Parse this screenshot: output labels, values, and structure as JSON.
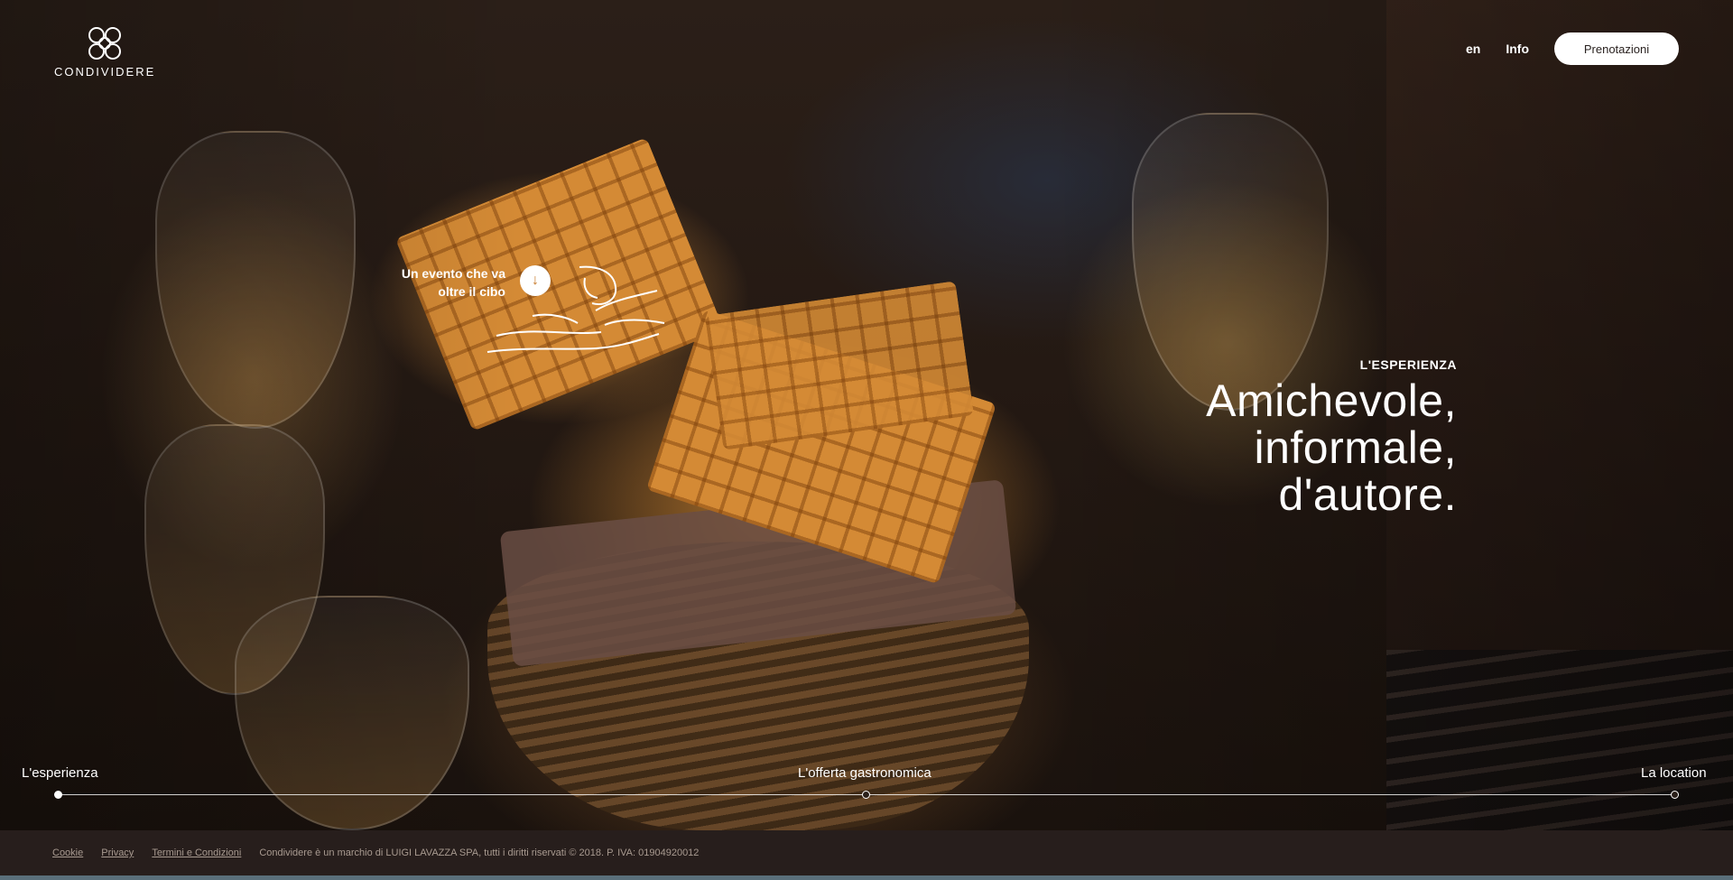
{
  "header": {
    "logo_text": "CONDIVIDERE",
    "nav": {
      "lang": "en",
      "info": "Info",
      "reserve": "Prenotazioni"
    }
  },
  "teaser": {
    "text_line1": "Un evento che va",
    "text_line2": "oltre il cibo",
    "arrow_icon": "arrow-down-icon"
  },
  "hero": {
    "eyebrow": "L'ESPERIENZA",
    "headline_line1": "Amichevole,",
    "headline_line2": "informale,",
    "headline_line3": "d'autore."
  },
  "timeline": {
    "stops": [
      {
        "label": "L'esperienza",
        "active": true
      },
      {
        "label": "L'offerta gastronomica",
        "active": false
      },
      {
        "label": "La location",
        "active": false
      }
    ]
  },
  "footer": {
    "links": [
      "Cookie",
      "Privacy",
      "Termini e Condizioni"
    ],
    "legal": "Condividere è un marchio di LUIGI LAVAZZA SPA, tutti i diritti riservati © 2018. P. IVA: 01904920012"
  },
  "colors": {
    "accent": "#c77a2c",
    "footer_bg": "#271e1c",
    "button_bg": "#ffffff"
  }
}
